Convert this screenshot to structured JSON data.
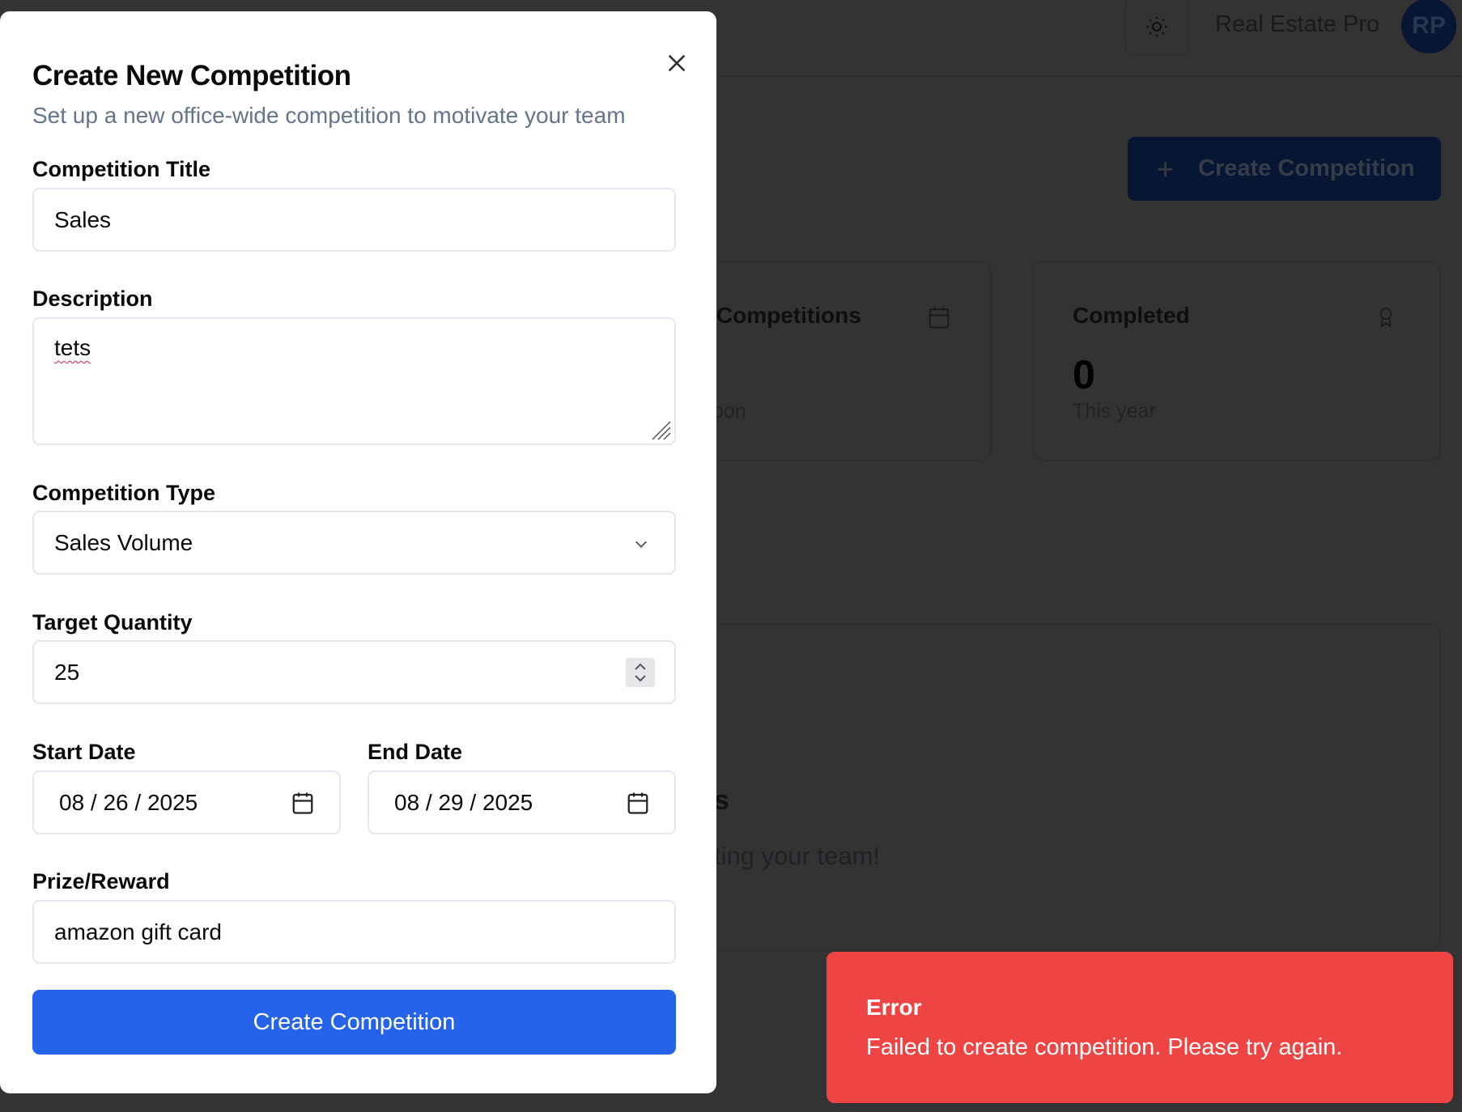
{
  "header": {
    "app_name": "Real Estate Pro",
    "avatar_initials": "RP",
    "theme_icon": "sun-icon"
  },
  "page": {
    "create_button_label": "Create Competition",
    "cards": [
      {
        "title_fragment": "g Competitions",
        "sub_fragment": "oon",
        "icon": "calendar-icon"
      },
      {
        "title": "Completed",
        "value": "0",
        "sub": "This year",
        "icon": "award-icon"
      }
    ],
    "empty_state": {
      "title_fragment": "s",
      "text_fragment": "ting your team!"
    }
  },
  "modal": {
    "title": "Create New Competition",
    "subtitle": "Set up a new office-wide competition to motivate your team",
    "fields": {
      "title": {
        "label": "Competition Title",
        "value": "Sales"
      },
      "description": {
        "label": "Description",
        "value": "tets"
      },
      "type": {
        "label": "Competition Type",
        "value": "Sales Volume"
      },
      "target": {
        "label": "Target Quantity",
        "value": "25"
      },
      "start_date": {
        "label": "Start Date",
        "value": "08 / 26 / 2025"
      },
      "end_date": {
        "label": "End Date",
        "value": "08 / 29 / 2025"
      },
      "prize": {
        "label": "Prize/Reward",
        "value": "amazon gift card"
      }
    },
    "submit_label": "Create Competition"
  },
  "toast": {
    "title": "Error",
    "message": "Failed to create competition. Please try again.",
    "color": "#ef4444"
  }
}
